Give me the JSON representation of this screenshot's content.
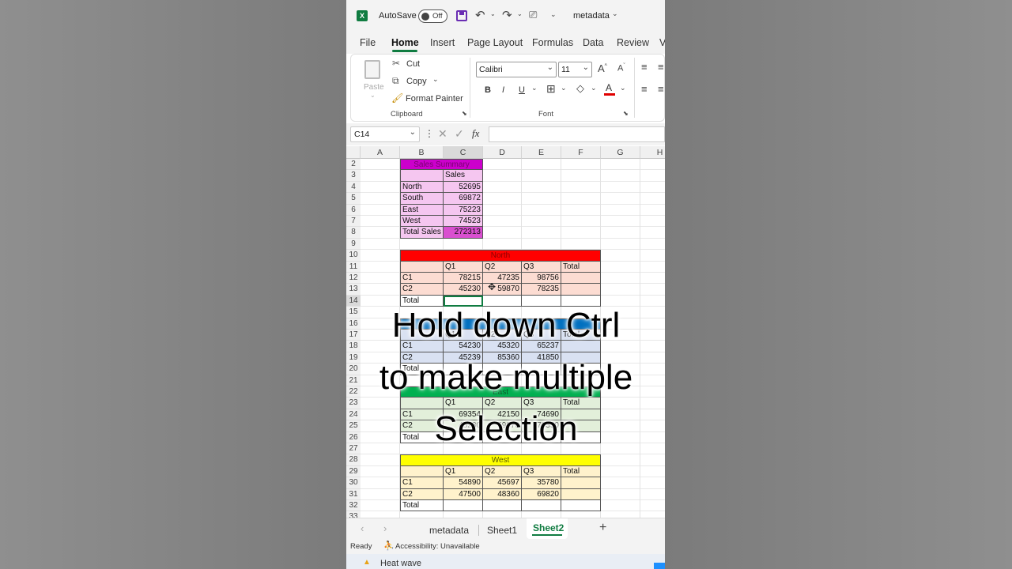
{
  "titlebar": {
    "autosave_label": "AutoSave",
    "toggle_state": "Off",
    "doc_title": "metadata"
  },
  "menu": {
    "tabs": [
      "File",
      "Home",
      "Insert",
      "Page Layout",
      "Formulas",
      "Data",
      "Review",
      "V"
    ],
    "active_tab": "Home"
  },
  "ribbon": {
    "paste_label": "Paste",
    "cut_label": "Cut",
    "copy_label": "Copy",
    "format_painter_label": "Format Painter",
    "clipboard_group": "Clipboard",
    "font_name": "Calibri",
    "font_size": "11",
    "font_group": "Font",
    "bold": "B",
    "italic": "I",
    "underline": "U"
  },
  "formula_bar": {
    "name_box": "C14",
    "fx": "fx",
    "value": ""
  },
  "columns": [
    "A",
    "B",
    "C",
    "D",
    "E",
    "F",
    "G",
    "H"
  ],
  "rows": [
    "2",
    "3",
    "4",
    "5",
    "6",
    "7",
    "8",
    "9",
    "10",
    "11",
    "12",
    "13",
    "14",
    "15",
    "16",
    "17",
    "18",
    "19",
    "20",
    "21",
    "22",
    "23",
    "24",
    "25",
    "26",
    "27",
    "28",
    "29",
    "30",
    "31",
    "32",
    "33"
  ],
  "summary": {
    "title": "Sales Summary",
    "header": "Sales",
    "items": [
      {
        "region": "North",
        "sales": "52695"
      },
      {
        "region": "South",
        "sales": "69872"
      },
      {
        "region": "East",
        "sales": "75223"
      },
      {
        "region": "West",
        "sales": "74523"
      }
    ],
    "total_label": "Total Sales",
    "total_value": "272313"
  },
  "tables": [
    {
      "title": "North",
      "headers": [
        "Q1",
        "Q2",
        "Q3",
        "Total"
      ],
      "rows": [
        {
          "label": "C1",
          "values": [
            "78215",
            "47235",
            "98756",
            ""
          ]
        },
        {
          "label": "C2",
          "values": [
            "45230",
            "59870",
            "78235",
            ""
          ]
        }
      ],
      "total_label": "Total"
    },
    {
      "title": "",
      "headers": [
        "Q1",
        "Q2",
        "Q3",
        "Total"
      ],
      "rows": [
        {
          "label": "C1",
          "values": [
            "54230",
            "45320",
            "65237",
            ""
          ]
        },
        {
          "label": "C2",
          "values": [
            "45239",
            "85360",
            "41850",
            ""
          ]
        }
      ],
      "total_label": "Total"
    },
    {
      "title": "East",
      "headers": [
        "Q1",
        "Q2",
        "Q3",
        "Total"
      ],
      "rows": [
        {
          "label": "C1",
          "values": [
            "69354",
            "42150",
            "74690",
            ""
          ]
        },
        {
          "label": "C2",
          "values": [
            "45230",
            "59870",
            "78350",
            ""
          ]
        }
      ],
      "total_label": "Total"
    },
    {
      "title": "West",
      "headers": [
        "Q1",
        "Q2",
        "Q3",
        "Total"
      ],
      "rows": [
        {
          "label": "C1",
          "values": [
            "54890",
            "45697",
            "35780",
            ""
          ]
        },
        {
          "label": "C2",
          "values": [
            "47500",
            "48360",
            "69820",
            ""
          ]
        }
      ],
      "total_label": "Total"
    }
  ],
  "sheet_tabs": [
    "metadata",
    "Sheet1",
    "Sheet2"
  ],
  "active_sheet": "Sheet2",
  "status": {
    "ready": "Ready",
    "accessibility": "Accessibility: Unavailable"
  },
  "taskbar": {
    "weather": "Heat wave"
  },
  "caption": {
    "line1": "Hold down Ctrl",
    "line2": "to make multiple",
    "line3": "Selection"
  },
  "colors": {
    "accent": "#107c41",
    "summary_title": "#cc00cc",
    "summary_fill": "#f5c6f0",
    "north_title": "#ff0000",
    "north_fill": "#fcdcd2",
    "south_title": "#0070c0",
    "south_fill": "#d9e1f2",
    "east_title": "#00b050",
    "east_fill": "#e2efda",
    "west_title": "#ffff00",
    "west_fill": "#fff2cc"
  }
}
